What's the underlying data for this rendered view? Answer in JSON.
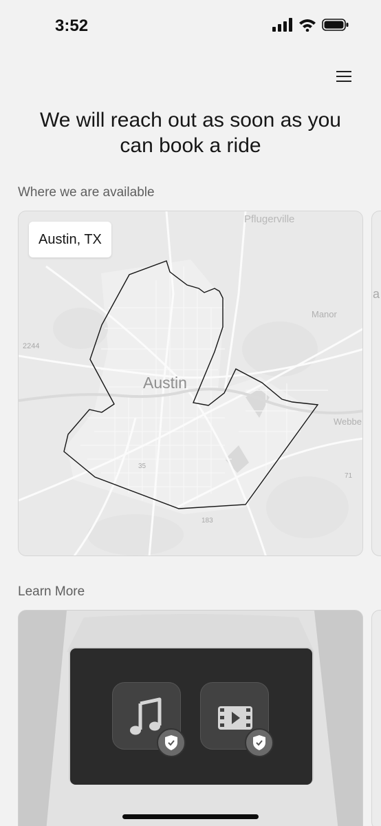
{
  "status_bar": {
    "time": "3:52"
  },
  "header": {
    "headline": "We will reach out as soon as you can book a ride"
  },
  "availability": {
    "section_title": "Where we are available",
    "city_chip": "Austin, TX",
    "map": {
      "city_label": "Austin",
      "place_labels": [
        "Pflugerville",
        "Manor",
        "Webbe",
        "2244",
        "35",
        "183",
        "71"
      ]
    },
    "next_card_letter": "a"
  },
  "learn_more": {
    "section_title": "Learn More",
    "tiles": [
      {
        "icon": "music-note-icon"
      },
      {
        "icon": "video-icon"
      }
    ],
    "badge_icon": "shield-check-icon"
  },
  "colors": {
    "background": "#f2f2f2",
    "screen": "#2b2b2b",
    "outline": "#111111"
  }
}
